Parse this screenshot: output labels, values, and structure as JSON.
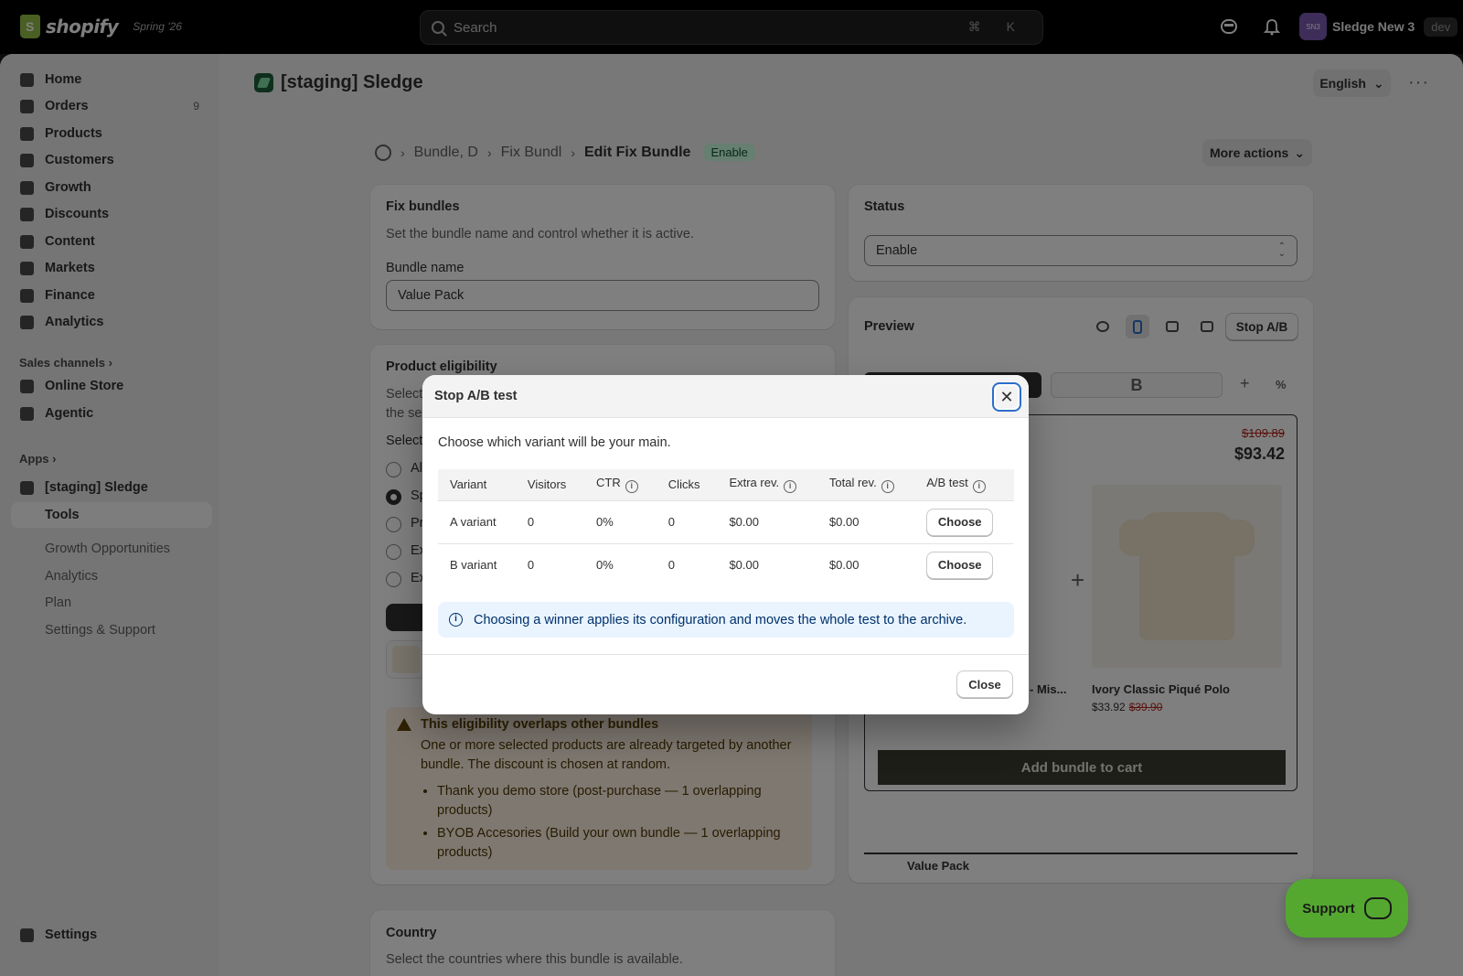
{
  "topbar": {
    "brand": "shopify",
    "tag": "Spring '26",
    "search_placeholder": "Search",
    "shortcut": "⌘ K",
    "store_initials": "SN3",
    "store_name": "Sledge New 3",
    "env_badge": "dev"
  },
  "sidebar": {
    "items": [
      {
        "label": "Home",
        "icon": "home-icon"
      },
      {
        "label": "Orders",
        "icon": "orders-icon",
        "count": "9"
      },
      {
        "label": "Products",
        "icon": "tag-icon"
      },
      {
        "label": "Customers",
        "icon": "person-icon"
      },
      {
        "label": "Growth",
        "icon": "growth-icon"
      },
      {
        "label": "Discounts",
        "icon": "discount-icon"
      },
      {
        "label": "Content",
        "icon": "content-icon"
      },
      {
        "label": "Markets",
        "icon": "globe-icon"
      },
      {
        "label": "Finance",
        "icon": "bank-icon"
      },
      {
        "label": "Analytics",
        "icon": "chart-icon"
      }
    ],
    "sales_channels_label": "Sales channels",
    "channels": [
      {
        "label": "Online Store",
        "icon": "store-icon"
      },
      {
        "label": "Agentic",
        "icon": "agentic-icon"
      }
    ],
    "apps_label": "Apps",
    "app_name": "[staging] Sledge",
    "app_sub": [
      "Tools",
      "Growth Opportunities",
      "Analytics",
      "Plan",
      "Settings & Support"
    ],
    "settings_label": "Settings"
  },
  "header": {
    "app_title": "[staging] Sledge",
    "language": "English",
    "breadcrumb": [
      "Bundle, D",
      "Fix Bundl",
      "Edit Fix Bundle"
    ],
    "status_badge": "Enable",
    "more_actions": "More actions"
  },
  "fix_bundles": {
    "title": "Fix bundles",
    "subtitle": "Set the bundle name and control whether it is active.",
    "name_label": "Bundle name",
    "name_value": "Value Pack"
  },
  "eligibility": {
    "title": "Product eligibility",
    "desc_1": "Select",
    "desc_2": "the se",
    "select_label": "Select",
    "options": [
      "Al",
      "Sp",
      "Pr",
      "Ex",
      "Ex"
    ],
    "selected_index": 1,
    "warning": {
      "title": "This eligibility overlaps other bundles",
      "text": "One or more selected products are already targeted by another bundle. The discount is chosen at random.",
      "items": [
        {
          "name": "Thank you demo store",
          "detail": " (post-purchase — 1 overlapping products)"
        },
        {
          "name": "BYOB Accesories",
          "detail": " (Build your own bundle — 1 overlapping products)"
        }
      ]
    }
  },
  "country": {
    "title": "Country",
    "subtitle": "Select the countries where this bundle is available."
  },
  "status_card": {
    "title": "Status",
    "value": "Enable"
  },
  "preview": {
    "title": "Preview",
    "stop_ab": "Stop A/B",
    "tab_b": "B",
    "price_old": "$109.89",
    "price_new": "$93.42",
    "product_1_name": "- Mis...",
    "product_2_name": "Ivory Classic Piqué Polo",
    "product_2_price": "$33.92",
    "product_2_old": "$39.90",
    "add_to_cart": "Add bundle to cart",
    "bottom_label": "Value Pack"
  },
  "modal": {
    "title": "Stop A/B test",
    "lead": "Choose which variant will be your main.",
    "columns": [
      "Variant",
      "Visitors",
      "CTR",
      "Clicks",
      "Extra rev.",
      "Total rev.",
      "A/B test"
    ],
    "rows": [
      {
        "variant": "A variant",
        "visitors": "0",
        "ctr": "0%",
        "clicks": "0",
        "extra": "$0.00",
        "total": "$0.00",
        "action": "Choose"
      },
      {
        "variant": "B variant",
        "visitors": "0",
        "ctr": "0%",
        "clicks": "0",
        "extra": "$0.00",
        "total": "$0.00",
        "action": "Choose"
      }
    ],
    "info": "Choosing a winner applies its configuration and moves the whole test to the archive.",
    "close": "Close"
  },
  "support": {
    "label": "Support"
  },
  "colors": {
    "accent_green": "#54a830",
    "badge_green_bg": "#cdfee1",
    "warning_bg": "#fff1e3",
    "info_bg": "#eaf4ff",
    "focus_blue": "#2c6ecb"
  }
}
